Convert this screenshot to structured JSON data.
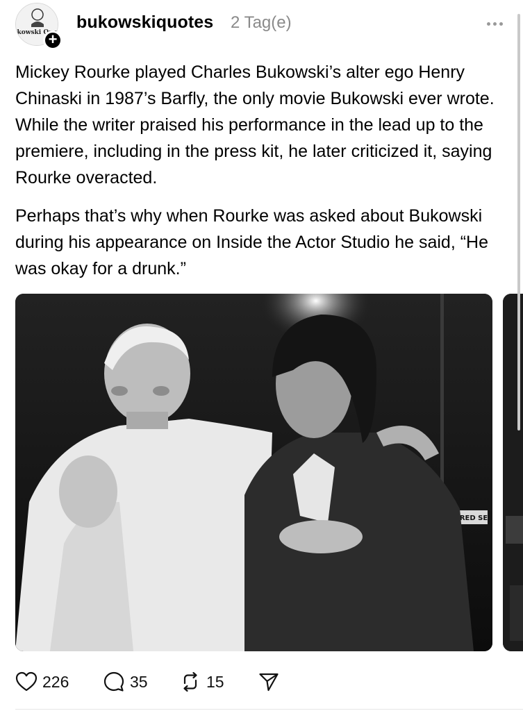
{
  "header": {
    "username": "bukowskiquotes",
    "timestamp": "2 Tag(e)",
    "avatar_label": "Bukowski Quotes"
  },
  "post": {
    "paragraphs": [
      "Mickey Rourke played Charles Bukowski’s alter ego Henry Chinaski in 1987’s Barfly, the only movie Bukowski ever wrote. While the writer praised his performance in the lead up to the premiere, including in the press kit, he later criticized it, saying Rourke overacted.",
      "Perhaps that’s why when Rourke was asked about Bukowski during his appearance on Inside the Actor Studio he said, “He was okay for a drunk.”"
    ],
    "image_sign_text": "RED SE"
  },
  "actions": {
    "likes": "226",
    "replies": "35",
    "reposts": "15",
    "icons": [
      "heart-icon",
      "comment-icon",
      "repost-icon",
      "share-icon"
    ]
  },
  "colors": {
    "text": "#000000",
    "muted": "#8a8a8a",
    "divider": "#e6e6e6"
  }
}
